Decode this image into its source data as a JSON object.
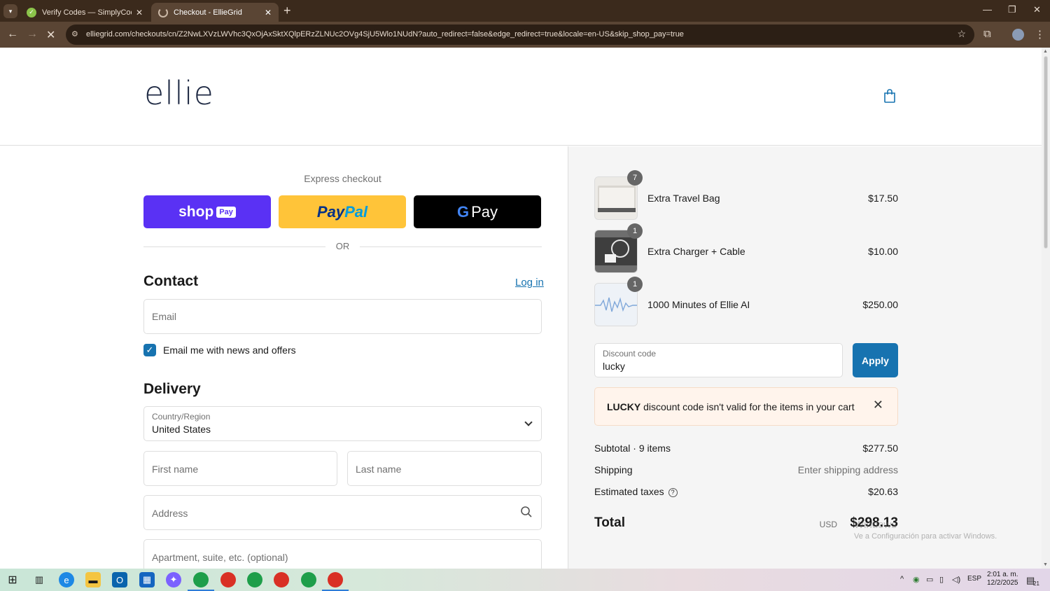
{
  "browser": {
    "tabs": [
      {
        "title": "Verify Codes — SimplyCodes"
      },
      {
        "title": "Checkout - EllieGrid"
      }
    ],
    "url": "elliegrid.com/checkouts/cn/Z2NwLXVzLWVhc3QxOjAxSktXQlpERzZLNUc2OVg4SjU5Wlo1NUdN?auto_redirect=false&edge_redirect=true&locale=en-US&skip_shop_pay=true",
    "icons": [
      "tab-list-icon",
      "close-icon",
      "new-tab-icon",
      "minimize-icon",
      "restore-icon",
      "back-icon",
      "forward-icon",
      "stop-icon",
      "site-settings-icon",
      "bookmark-star-icon",
      "extensions-icon",
      "profile-icon",
      "menu-icon"
    ]
  },
  "header": {
    "logo": "ellie",
    "cart_icon": "shopping-bag-icon"
  },
  "express": {
    "title": "Express checkout",
    "shop_pay": {
      "word": "shop",
      "badge": "Pay"
    },
    "paypal": {
      "part1": "Pay",
      "part2": "Pal"
    },
    "gpay": {
      "g": "G",
      "pay": "Pay"
    },
    "divider": "OR"
  },
  "contact": {
    "heading": "Contact",
    "login": "Log in",
    "email_placeholder": "Email",
    "newsletter_label": "Email me with news and offers",
    "newsletter_checked": true
  },
  "delivery": {
    "heading": "Delivery",
    "country_label": "Country/Region",
    "country_value": "United States",
    "first_name_placeholder": "First name",
    "last_name_placeholder": "Last name",
    "address_placeholder": "Address",
    "apartment_placeholder": "Apartment, suite, etc. (optional)"
  },
  "cart": {
    "items": [
      {
        "qty": "7",
        "name": "Extra Travel Bag",
        "price": "$17.50"
      },
      {
        "qty": "1",
        "name": "Extra Charger + Cable",
        "price": "$10.00"
      },
      {
        "qty": "1",
        "name": "1000 Minutes of Ellie AI",
        "price": "$250.00"
      }
    ],
    "discount_label": "Discount code",
    "discount_value": "lucky",
    "apply_label": "Apply",
    "alert": {
      "code": "LUCKY",
      "message": " discount code isn't valid for the items in your cart"
    },
    "subtotal_label": "Subtotal · 9 items",
    "subtotal_value": "$277.50",
    "shipping_label": "Shipping",
    "shipping_value": "Enter shipping address",
    "taxes_label": "Estimated taxes",
    "taxes_value": "$20.63",
    "total_label": "Total",
    "currency": "USD",
    "total_value": "$298.13"
  },
  "watermark": {
    "line1": "Windows",
    "line2": "Ve a Configuración para activar Windows."
  },
  "taskbar": {
    "language": "ESP",
    "time": "2:01 a. m.",
    "date": "12/2/2025",
    "notifications": "21"
  },
  "colors": {
    "accent": "#1773b0",
    "shop_pay": "#5a31f4",
    "paypal": "#ffc439",
    "chrome": "#3b2a1c"
  }
}
